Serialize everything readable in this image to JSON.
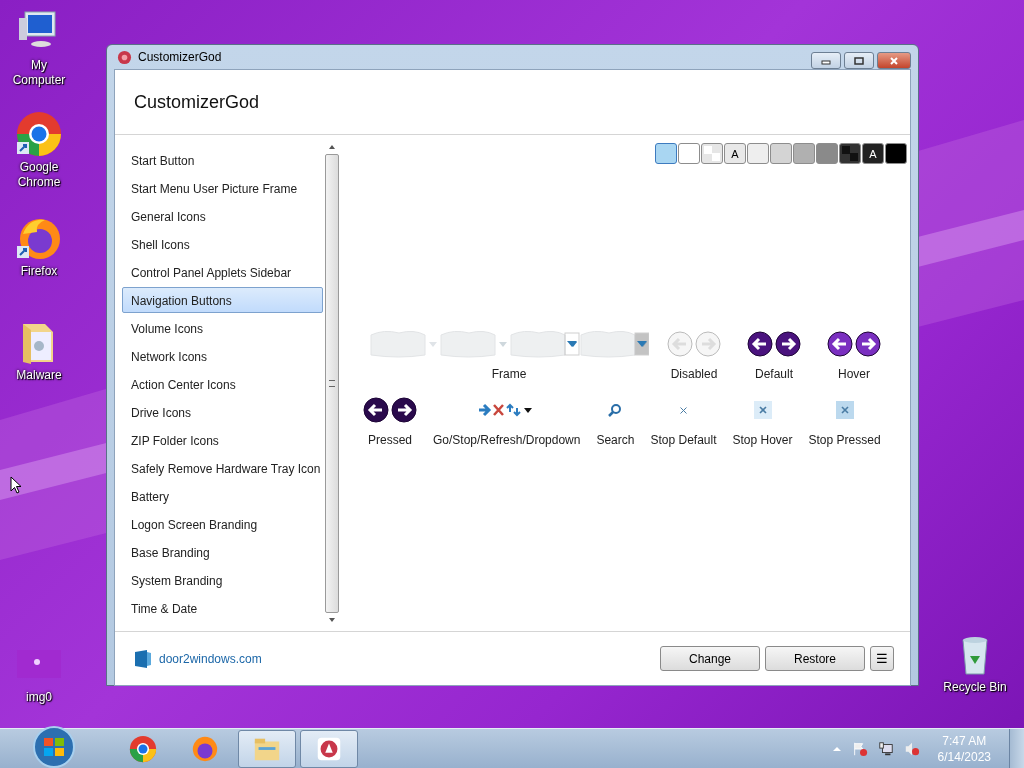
{
  "desktop_icons": [
    {
      "kind": "computer",
      "label": "My Computer"
    },
    {
      "kind": "chrome",
      "label": "Google Chrome"
    },
    {
      "kind": "firefox",
      "label": "Firefox"
    },
    {
      "kind": "folder",
      "label": "Malware"
    },
    {
      "kind": "image",
      "label": "img0"
    },
    {
      "kind": "recycle",
      "label": "Recycle Bin"
    }
  ],
  "window": {
    "title": "CustomizerGod",
    "heading": "CustomizerGod",
    "sidebar": {
      "items": [
        {
          "label": "Start Button",
          "selected": false
        },
        {
          "label": "Start Menu User Picture Frame",
          "selected": false
        },
        {
          "label": "General Icons",
          "selected": false
        },
        {
          "label": "Shell Icons",
          "selected": false
        },
        {
          "label": "Control Panel Applets Sidebar",
          "selected": false
        },
        {
          "label": "Navigation Buttons",
          "selected": true
        },
        {
          "label": "Volume Icons",
          "selected": false
        },
        {
          "label": "Network Icons",
          "selected": false
        },
        {
          "label": "Action Center Icons",
          "selected": false
        },
        {
          "label": "Drive Icons",
          "selected": false
        },
        {
          "label": "ZIP Folder Icons",
          "selected": false
        },
        {
          "label": "Safely Remove Hardware Tray Icon",
          "selected": false
        },
        {
          "label": "Battery",
          "selected": false
        },
        {
          "label": "Logon Screen Branding",
          "selected": false
        },
        {
          "label": "Base Branding",
          "selected": false
        },
        {
          "label": "System Branding",
          "selected": false
        },
        {
          "label": "Time & Date",
          "selected": false
        }
      ]
    },
    "swatches": [
      {
        "color": "#a9d6f2",
        "selected": true
      },
      {
        "color": "#ffffff",
        "selected": false
      },
      {
        "color": "#e6e6e6",
        "kind": "checker",
        "selected": false
      },
      {
        "color": "#e8e8e8",
        "label": "A",
        "selected": false
      },
      {
        "color": "#eeeeee",
        "selected": false
      },
      {
        "color": "#d4d4d4",
        "selected": false
      },
      {
        "color": "#b0b0b0",
        "selected": false
      },
      {
        "color": "#8a8a8a",
        "selected": false
      },
      {
        "color": "#333333",
        "kind": "checker",
        "selected": false
      },
      {
        "color": "#222222",
        "label": "A",
        "selected": false
      },
      {
        "color": "#000000",
        "selected": false
      }
    ],
    "preview_rows": [
      [
        {
          "kind": "frame",
          "label": "Frame"
        },
        {
          "kind": "nav",
          "disabled": true,
          "hover": false,
          "pressed": false,
          "label": "Disabled"
        },
        {
          "kind": "nav",
          "disabled": false,
          "hover": false,
          "pressed": false,
          "label": "Default"
        },
        {
          "kind": "nav",
          "disabled": false,
          "hover": true,
          "pressed": false,
          "label": "Hover"
        }
      ],
      [
        {
          "kind": "nav",
          "disabled": false,
          "hover": false,
          "pressed": true,
          "label": "Pressed"
        },
        {
          "kind": "toolbar",
          "label": "Go/Stop/Refresh/Dropdown"
        },
        {
          "kind": "search",
          "label": "Search"
        },
        {
          "kind": "stop",
          "hover": false,
          "pressed": false,
          "label": "Stop Default"
        },
        {
          "kind": "stop",
          "hover": true,
          "pressed": false,
          "label": "Stop Hover"
        },
        {
          "kind": "stop",
          "hover": false,
          "pressed": true,
          "label": "Stop Pressed"
        }
      ]
    ],
    "footer": {
      "link": "door2windows.com",
      "buttons": [
        "Change",
        "Restore"
      ],
      "menu_glyph": "☰"
    }
  },
  "taskbar": {
    "apps": [
      {
        "kind": "chrome",
        "open": false
      },
      {
        "kind": "firefox",
        "open": false
      },
      {
        "kind": "explorer",
        "open": true
      },
      {
        "kind": "customizer",
        "open": true
      }
    ],
    "time": "7:47 AM",
    "date": "6/14/2023"
  }
}
